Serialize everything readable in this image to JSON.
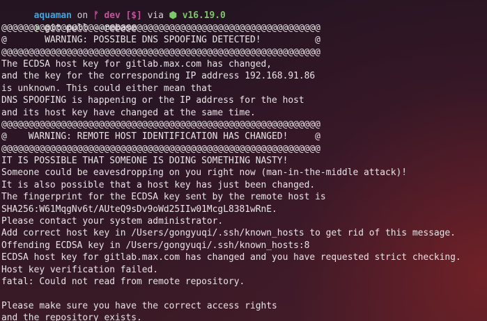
{
  "prompt": {
    "user": "aquaman",
    "on": "on",
    "branch_icon": "git-branch-icon",
    "branch_glyph": "ᚠ",
    "branch": "dev",
    "status": "[$]",
    "via": "via",
    "node_icon": "node-icon",
    "node_glyph": "⬢",
    "node_version": "v16.19.0",
    "arrow": "❯",
    "command": "git pull --rebase"
  },
  "output_lines": [
    "@@@@@@@@@@@@@@@@@@@@@@@@@@@@@@@@@@@@@@@@@@@@@@@@@@@@@@@@@@@",
    "@       WARNING: POSSIBLE DNS SPOOFING DETECTED!          @",
    "@@@@@@@@@@@@@@@@@@@@@@@@@@@@@@@@@@@@@@@@@@@@@@@@@@@@@@@@@@@",
    "The ECDSA host key for gitlab.max.com has changed,",
    "and the key for the corresponding IP address 192.168.91.86",
    "is unknown. This could either mean that",
    "DNS SPOOFING is happening or the IP address for the host",
    "and its host key have changed at the same time.",
    "@@@@@@@@@@@@@@@@@@@@@@@@@@@@@@@@@@@@@@@@@@@@@@@@@@@@@@@@@@@",
    "@    WARNING: REMOTE HOST IDENTIFICATION HAS CHANGED!     @",
    "@@@@@@@@@@@@@@@@@@@@@@@@@@@@@@@@@@@@@@@@@@@@@@@@@@@@@@@@@@@",
    "IT IS POSSIBLE THAT SOMEONE IS DOING SOMETHING NASTY!",
    "Someone could be eavesdropping on you right now (man-in-the-middle attack)!",
    "It is also possible that a host key has just been changed.",
    "The fingerprint for the ECDSA key sent by the remote host is",
    "SHA256:W61MqgNv6t/AUteQ9sDv9oWd25IIw01McgL8381wRnE.",
    "Please contact your system administrator.",
    "Add correct host key in /Users/gongyuqi/.ssh/known_hosts to get rid of this message.",
    "Offending ECDSA key in /Users/gongyuqi/.ssh/known_hosts:8",
    "ECDSA host key for gitlab.max.com has changed and you have requested strict checking.",
    "Host key verification failed.",
    "fatal: Could not read from remote repository.",
    "",
    "Please make sure you have the correct access rights",
    "and the repository exists."
  ]
}
